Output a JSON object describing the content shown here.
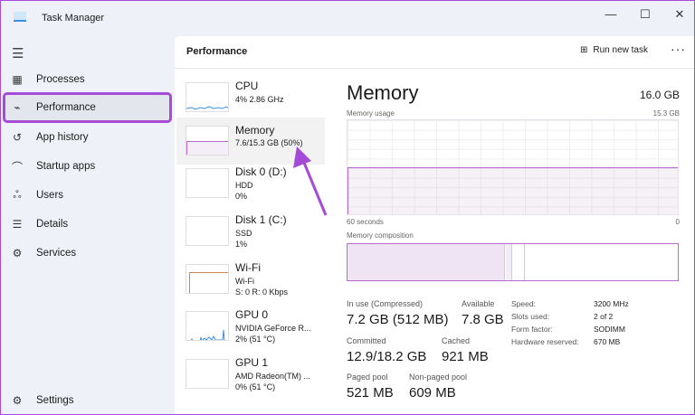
{
  "window": {
    "title": "Task Manager",
    "minimize": "—",
    "maximize": "☐",
    "close": "✕"
  },
  "sidebar": {
    "items": [
      {
        "label": "Processes",
        "icon": "▦"
      },
      {
        "label": "Performance",
        "icon": "⌁"
      },
      {
        "label": "App history",
        "icon": "↺"
      },
      {
        "label": "Startup apps",
        "icon": "⌒"
      },
      {
        "label": "Users",
        "icon": "ஃ"
      },
      {
        "label": "Details",
        "icon": "☰"
      },
      {
        "label": "Services",
        "icon": "⚙"
      }
    ],
    "settings": {
      "label": "Settings",
      "icon": "⚙"
    }
  },
  "header": {
    "title": "Performance",
    "run_new_task": "Run new task",
    "more": "···"
  },
  "devices": [
    {
      "name": "CPU",
      "line1": "4% 2.86 GHz",
      "line2": ""
    },
    {
      "name": "Memory",
      "line1": "7.6/15.3 GB (50%)",
      "line2": ""
    },
    {
      "name": "Disk 0 (D:)",
      "line1": "HDD",
      "line2": "0%"
    },
    {
      "name": "Disk 1 (C:)",
      "line1": "SSD",
      "line2": "1%"
    },
    {
      "name": "Wi-Fi",
      "line1": "Wi-Fi",
      "line2": "S: 0 R: 0 Kbps"
    },
    {
      "name": "GPU 0",
      "line1": "NVIDIA GeForce R...",
      "line2": "2% (51 °C)"
    },
    {
      "name": "GPU 1",
      "line1": "AMD Radeon(TM) ...",
      "line2": "0% (51 °C)"
    }
  ],
  "detail": {
    "title": "Memory",
    "total": "16.0 GB",
    "usage_label": "Memory usage",
    "usage_max": "15.3 GB",
    "time_left": "60 seconds",
    "time_right": "0",
    "usage_percent": 50,
    "composition_label": "Memory composition",
    "stats": [
      {
        "label": "In use (Compressed)",
        "value": "7.2 GB (512 MB)"
      },
      {
        "label": "Available",
        "value": "7.8 GB"
      },
      {
        "label": "Committed",
        "value": "12.9/18.2 GB"
      },
      {
        "label": "Cached",
        "value": "921 MB"
      },
      {
        "label": "Paged pool",
        "value": "521 MB"
      },
      {
        "label": "Non-paged pool",
        "value": "609 MB"
      }
    ],
    "specs": [
      {
        "label": "Speed:",
        "value": "3200 MHz"
      },
      {
        "label": "Slots used:",
        "value": "2 of 2"
      },
      {
        "label": "Form factor:",
        "value": "SODIMM"
      },
      {
        "label": "Hardware reserved:",
        "value": "670 MB"
      }
    ]
  },
  "colors": {
    "accent": "#a64bd8",
    "memory": "#b66ccf"
  }
}
